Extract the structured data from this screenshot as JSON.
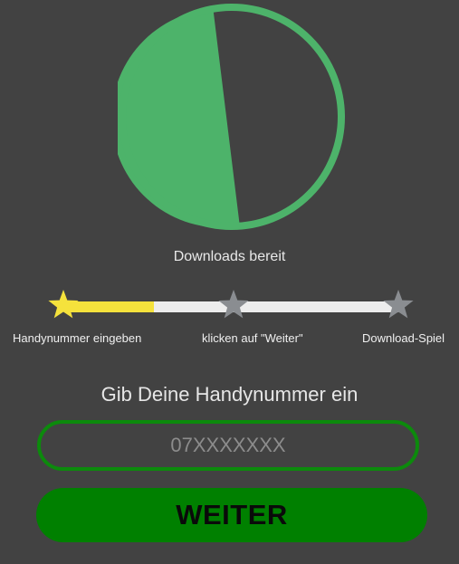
{
  "progress": {
    "fraction_complete": 0.53,
    "caption": "Downloads bereit",
    "colors": {
      "fill": "#4db36a",
      "ring": "#4db36a",
      "empty": "#424242"
    }
  },
  "steps": {
    "current_step_progress": 0.27,
    "items": [
      {
        "label": "Handynummer eingeben",
        "icon": "star-icon",
        "state": "active"
      },
      {
        "label": "klicken auf \"Weiter\"",
        "icon": "star-icon",
        "state": "inactive"
      },
      {
        "label": "Download-Spiel",
        "icon": "star-icon",
        "state": "inactive"
      }
    ],
    "colors": {
      "active": "#f5e23c",
      "inactive": "#8a8d91",
      "track": "#ededed"
    }
  },
  "form": {
    "prompt": "Gib Deine Handynummer ein",
    "phone": {
      "value": "",
      "placeholder": "07XXXXXXX"
    },
    "submit_label": "WEITER",
    "colors": {
      "accent": "#008000",
      "border": "#0c8a0c"
    }
  }
}
